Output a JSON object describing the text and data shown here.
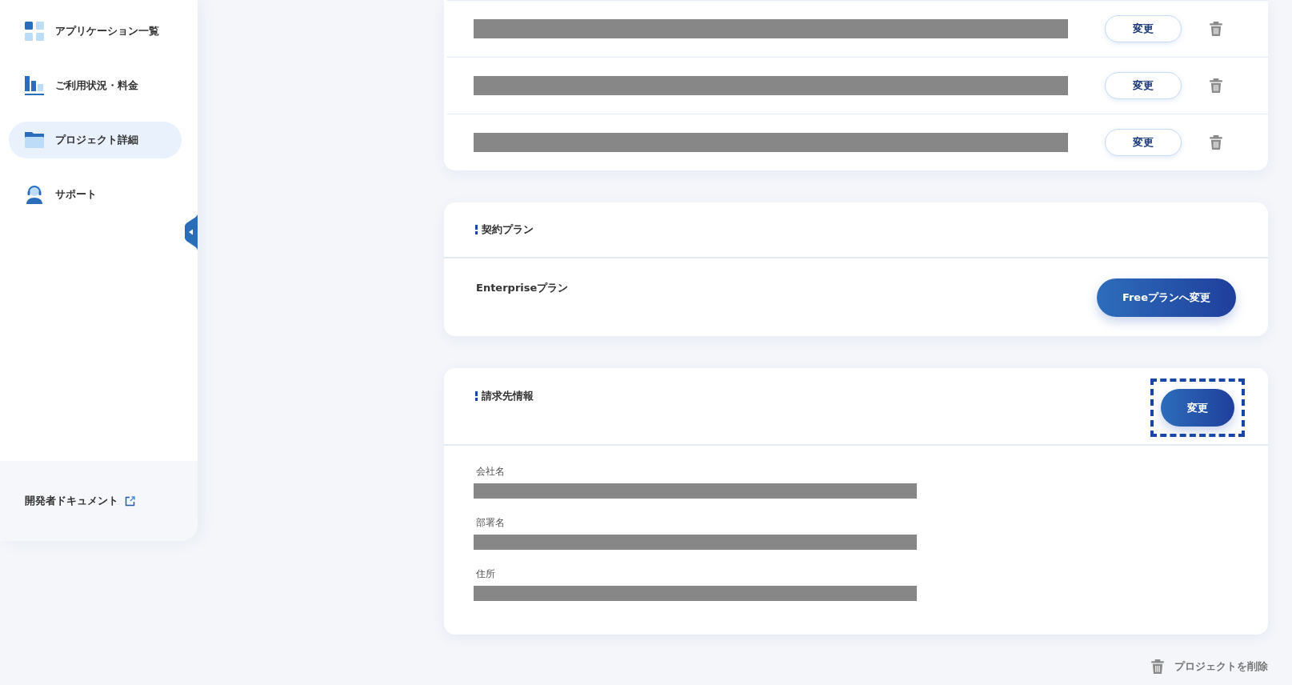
{
  "sidebar": {
    "items": [
      {
        "kind": "apps",
        "label": "アプリケーション一覧",
        "selected": false
      },
      {
        "kind": "usage",
        "label": "ご利用状況・料金",
        "selected": false
      },
      {
        "kind": "project",
        "label": "プロジェクト詳細",
        "selected": true
      },
      {
        "kind": "support",
        "label": "サポート",
        "selected": false
      }
    ],
    "footer_link": "開発者ドキュメント"
  },
  "app_list": {
    "rows": [
      {
        "button": "変更"
      },
      {
        "button": "変更"
      },
      {
        "button": "変更"
      }
    ]
  },
  "plan": {
    "title": "契約プラン",
    "current": "Enterpriseプラン",
    "button": "Freeプランへ変更"
  },
  "billing": {
    "title": "請求先情報",
    "button": "変更",
    "button_focused": true,
    "fields": [
      {
        "label": "会社名"
      },
      {
        "label": "部署名"
      },
      {
        "label": "住所"
      }
    ]
  },
  "delete_project": "プロジェクトを削除"
}
